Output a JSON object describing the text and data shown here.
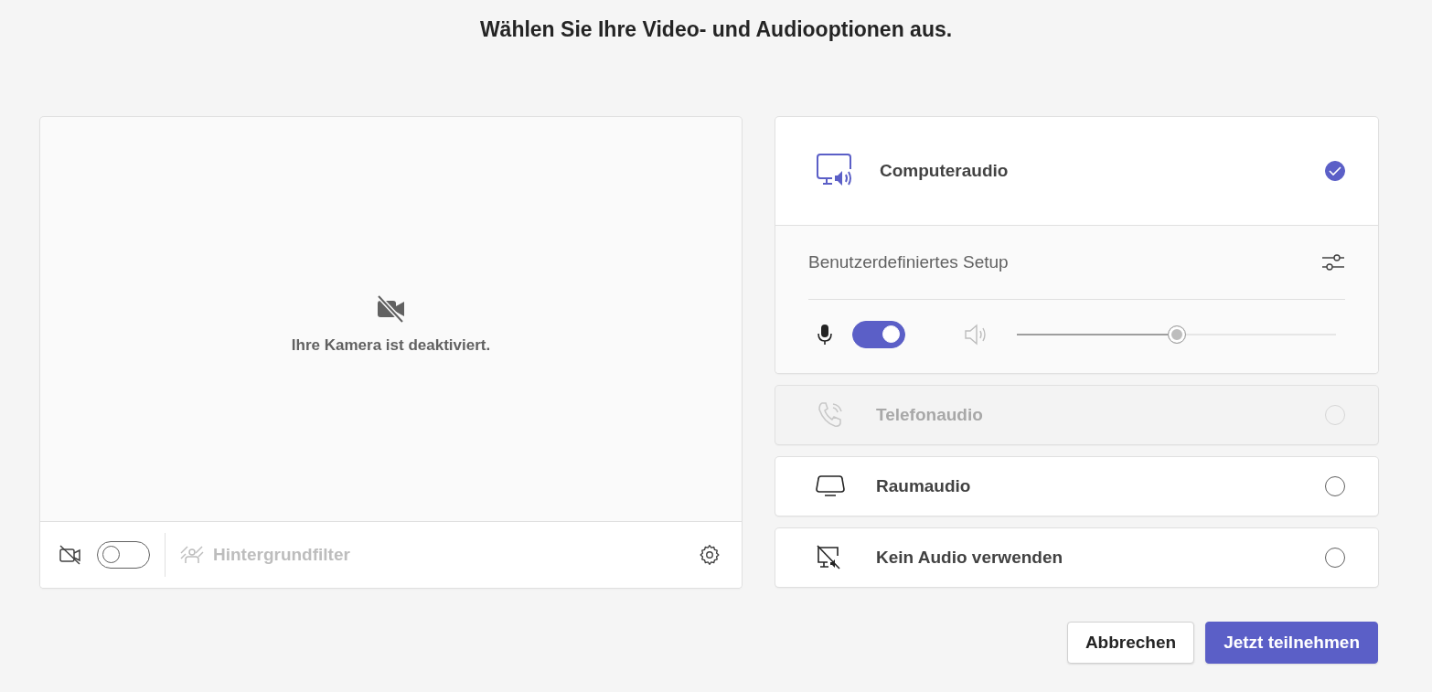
{
  "title": "Wählen Sie Ihre Video- und Audiooptionen aus.",
  "video": {
    "message": "Ihre Kamera ist deaktiviert.",
    "camera_on": false,
    "background_filter": {
      "label": "Hintergrundfilter",
      "disabled": true
    }
  },
  "audio_options": [
    {
      "kind": "computer",
      "label": "Computeraudio",
      "selected": true,
      "disabled": false,
      "setup": {
        "label": "Benutzerdefiniertes Setup",
        "mic_on": true,
        "level": 0.5
      }
    },
    {
      "kind": "phone",
      "label": "Telefonaudio",
      "selected": false,
      "disabled": true
    },
    {
      "kind": "room",
      "label": "Raumaudio",
      "selected": false,
      "disabled": false
    },
    {
      "kind": "none",
      "label": "Kein Audio verwenden",
      "selected": false,
      "disabled": false
    }
  ],
  "buttons": [
    {
      "kind": "secondary",
      "label": "Abbrechen"
    },
    {
      "kind": "primary",
      "label": "Jetzt teilnehmen"
    }
  ]
}
